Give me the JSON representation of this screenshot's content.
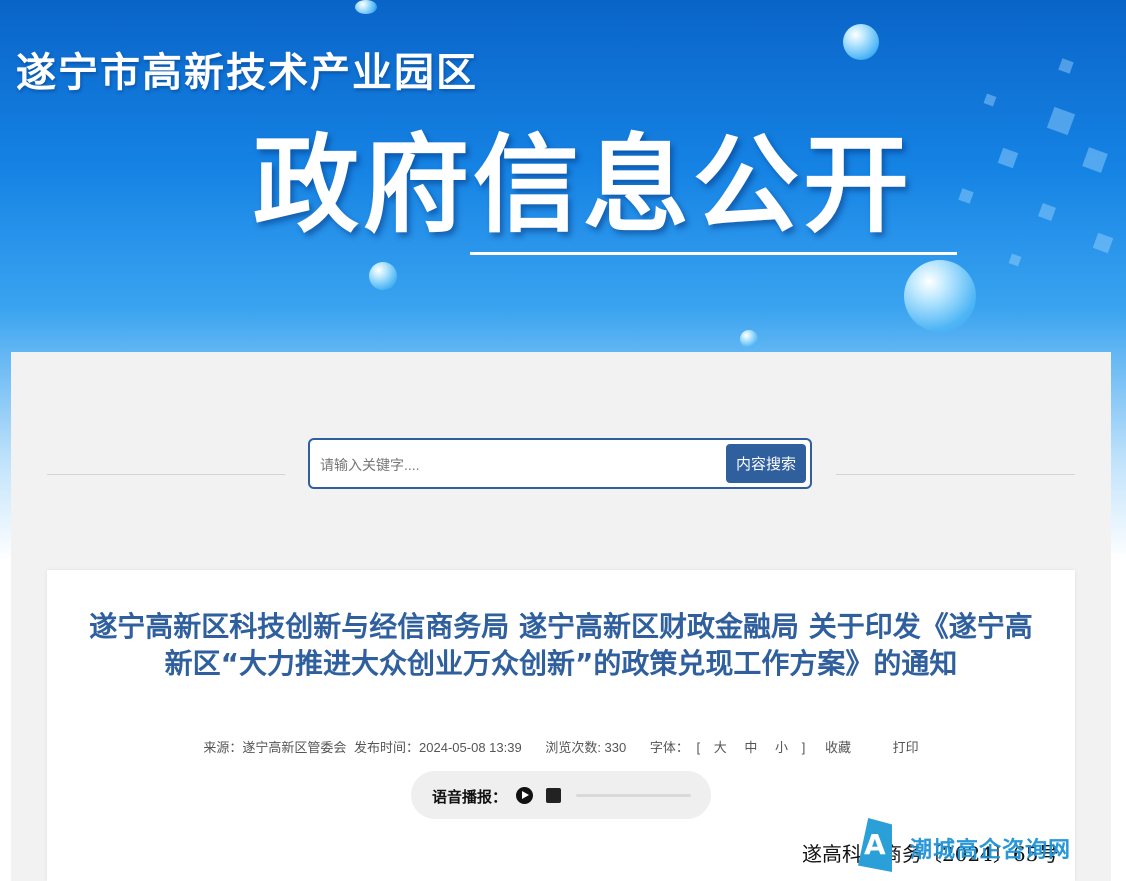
{
  "header": {
    "site_title": "遂宁市高新技术产业园区",
    "section_title": "政府信息公开"
  },
  "search": {
    "placeholder": "请输入关键字....",
    "button_label": "内容搜索"
  },
  "article": {
    "title": "遂宁高新区科技创新与经信商务局 遂宁高新区财政金融局 关于印发《遂宁高新区“大力推进大众创业万众创新”的政策兑现工作方案》的通知",
    "meta": {
      "source": "来源：遂宁高新区管委会",
      "publish_time": "发布时间：2024-05-08 13:39",
      "views": "浏览次数: 330",
      "font_label": "字体：",
      "bracket_open": "[",
      "font_large": "大",
      "font_medium": "中",
      "font_small": "小",
      "bracket_close": "]",
      "favorite": "收藏",
      "print": "打印"
    },
    "voice": {
      "label": "语音播报：",
      "play_icon": "play-icon",
      "stop_icon": "stop-icon"
    },
    "doc_number": "遂高科经商务〔2024〕65号"
  },
  "watermark": {
    "icon_letter": "A",
    "text": "潮城高企咨询网"
  },
  "colors": {
    "brand_blue": "#2f5f9d",
    "banner_blue": "#1583e4",
    "panel_bg": "#f2f2f2"
  }
}
